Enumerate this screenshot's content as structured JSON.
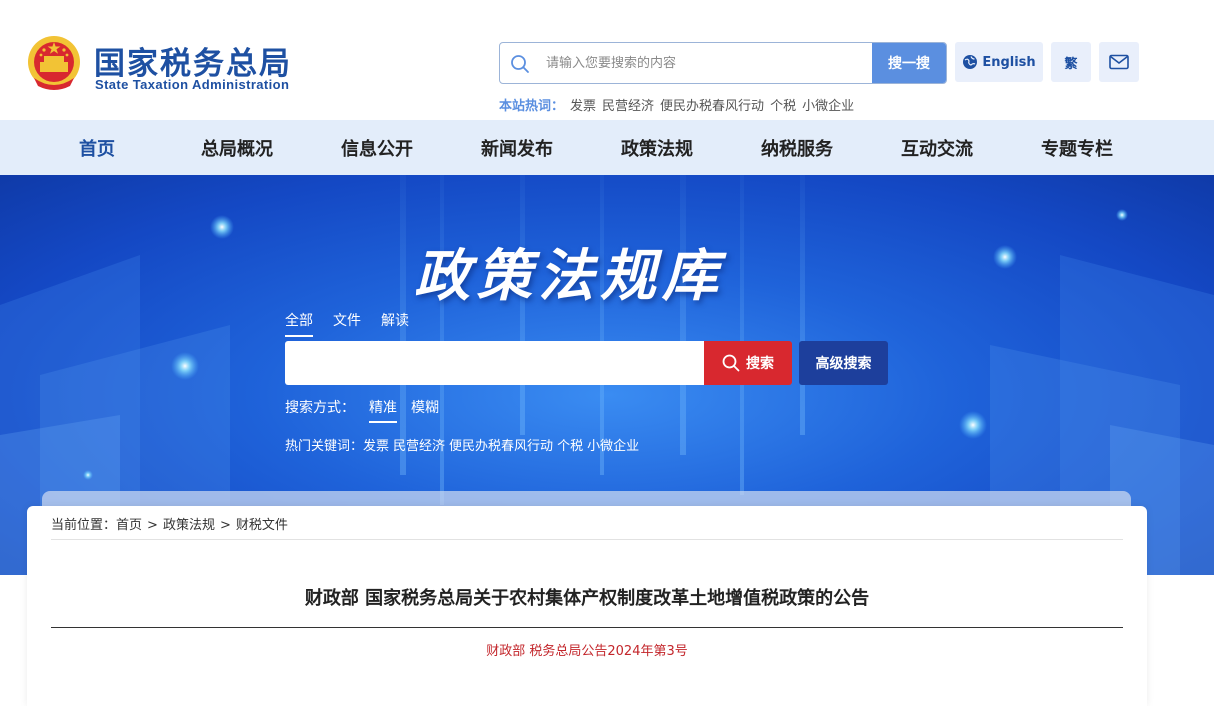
{
  "header": {
    "brand_cn": "国家税务总局",
    "brand_en": "State Taxation Administration",
    "search": {
      "placeholder": "请输入您要搜索的内容",
      "button_label": "搜一搜"
    },
    "english_label": "English",
    "traditional_label": "繁",
    "hotwords_label": "本站热词：",
    "hotwords": [
      "发票",
      "民营经济",
      "便民办税春风行动",
      "个税",
      "小微企业"
    ]
  },
  "nav": {
    "items": [
      "首页",
      "总局概况",
      "信息公开",
      "新闻发布",
      "政策法规",
      "纳税服务",
      "互动交流",
      "专题专栏"
    ]
  },
  "banner": {
    "title": "政策法规库",
    "tabs": [
      "全部",
      "文件",
      "解读"
    ],
    "search_button": "搜索",
    "advanced_button": "高级搜索",
    "mode_label": "搜索方式：",
    "modes": [
      "精准",
      "模糊"
    ],
    "hot_label": "热门关键词：",
    "hot_keywords": [
      "发票",
      "民营经济",
      "便民办税春风行动",
      "个税",
      "小微企业"
    ]
  },
  "breadcrumb": {
    "label": "当前位置：",
    "items": [
      "首页",
      "政策法规",
      "财税文件"
    ]
  },
  "document": {
    "title": "财政部 国家税务总局关于农村集体产权制度改革土地增值税政策的公告",
    "number": "财政部 税务总局公告2024年第3号"
  },
  "colors": {
    "brand_blue": "#1e50a2",
    "search_button": "#5b8fe0",
    "nav_bg": "#e3edfa",
    "red_button": "#d8282f",
    "dark_blue_button": "#1d3f9c",
    "doc_number_red": "#c3262b"
  }
}
